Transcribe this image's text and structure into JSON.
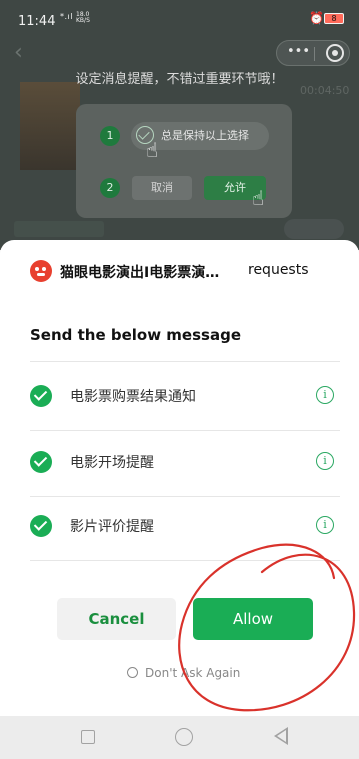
{
  "status_bar": {
    "time": "11:44",
    "signal": "*.ıl",
    "net_speed_top": "18.0",
    "net_speed_bottom": "KB/S",
    "battery": "8"
  },
  "background": {
    "hint_text": "设定消息提醒，不错过重要环节哦！",
    "elapsed": "00:04:50",
    "guide": {
      "step_1": "1",
      "step_2": "2",
      "always_keep_label": "总是保持以上选择",
      "cancel_label": "取消",
      "allow_label": "允许"
    }
  },
  "sheet": {
    "app_name": "猫眼电影演出I电影票演…",
    "requests_label": "requests",
    "title": "Send the below message",
    "messages": [
      {
        "label": "电影票购票结果通知",
        "checked": true,
        "info_icon": "i"
      },
      {
        "label": "电影开场提醒",
        "checked": true,
        "info_icon": "i"
      },
      {
        "label": "影片评价提醒",
        "checked": true,
        "info_icon": "i"
      }
    ],
    "cancel_label": "Cancel",
    "allow_label": "Allow",
    "dont_ask_label": "Don't Ask Again"
  },
  "colors": {
    "accent_green": "#1aad55",
    "annotation_red": "#d9322b",
    "app_logo_red": "#e8402f"
  }
}
